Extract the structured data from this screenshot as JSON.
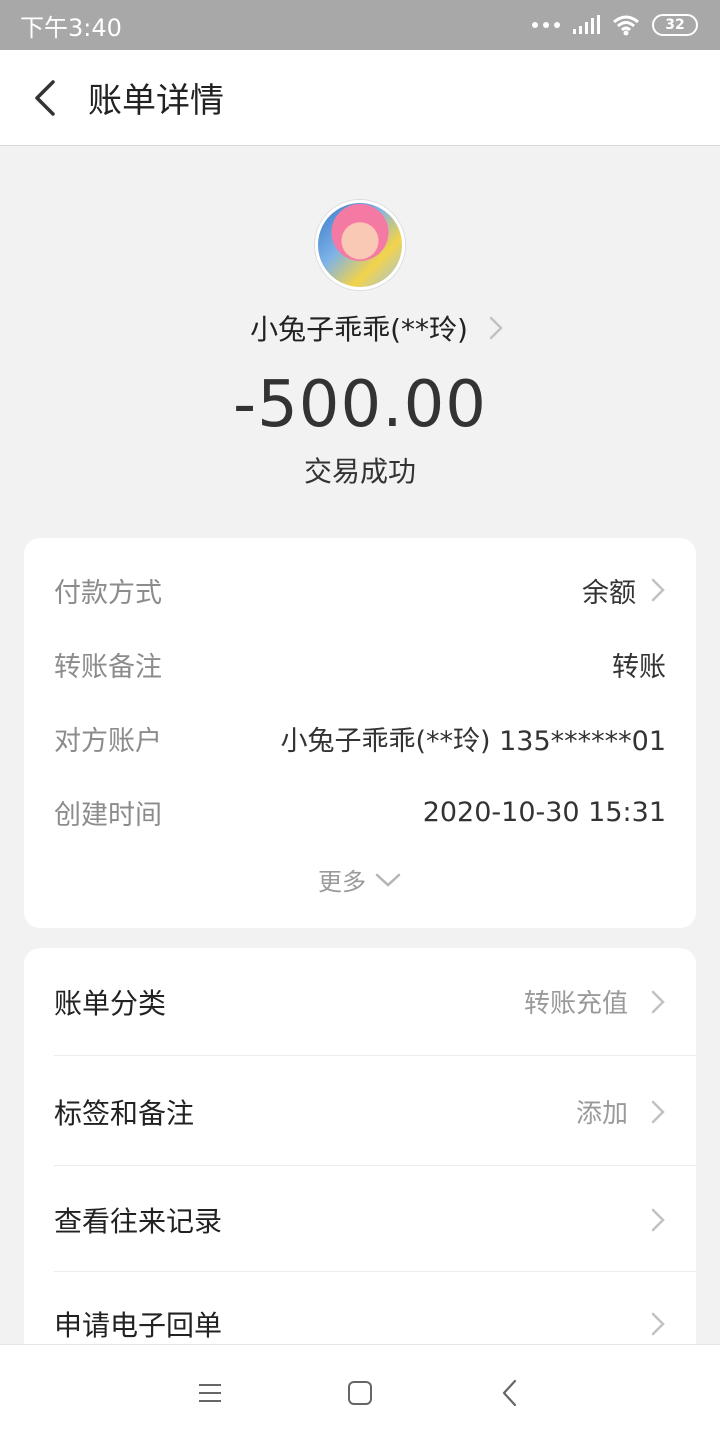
{
  "status_bar": {
    "time": "下午3:40",
    "battery": "32"
  },
  "header": {
    "title": "账单详情"
  },
  "profile": {
    "name": "小兔子乖乖(**玲)",
    "amount": "-500.00",
    "status": "交易成功"
  },
  "info": {
    "rows": [
      {
        "label": "付款方式",
        "value": "余额"
      },
      {
        "label": "转账备注",
        "value": "转账"
      },
      {
        "label": "对方账户",
        "value": "小兔子乖乖(**玲) 135******01"
      },
      {
        "label": "创建时间",
        "value": "2020-10-30 15:31"
      }
    ],
    "more": "更多"
  },
  "menu": {
    "items": [
      {
        "label": "账单分类",
        "value": "转账充值"
      },
      {
        "label": "标签和备注",
        "value": "添加"
      },
      {
        "label": "查看往来记录",
        "value": ""
      },
      {
        "label": "申请电子回单",
        "value": ""
      }
    ]
  },
  "icons": {
    "back": "back-arrow-icon",
    "chevron": "chevron-right-icon",
    "more": "chevron-down-icon",
    "nav_menu": "menu-icon",
    "nav_home": "home-icon",
    "nav_back": "back-icon"
  }
}
